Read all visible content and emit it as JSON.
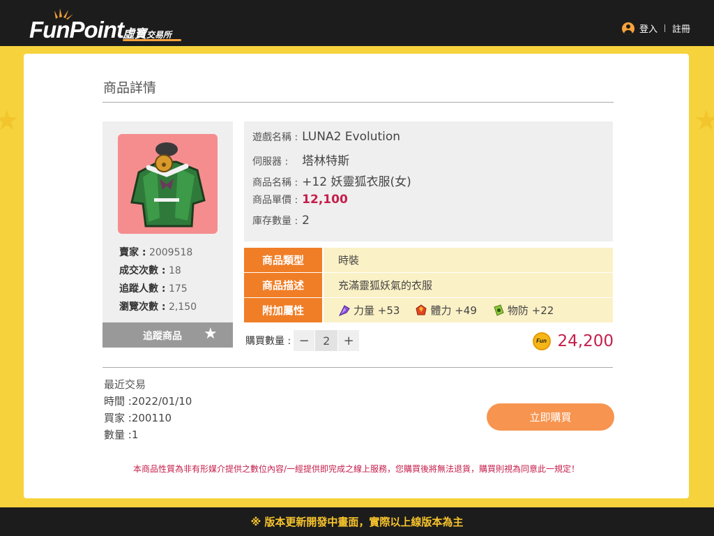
{
  "header": {
    "logo_text_main": "FunPoint",
    "logo_text_sub": "虛寶",
    "logo_text_sub_small": "交易所",
    "login_label": "登入",
    "register_label": "註冊"
  },
  "page_title": "商品詳情",
  "seller_panel": {
    "seller_label": "賣家 :",
    "seller_value": "2009518",
    "deals_label": "成交次數 :",
    "deals_value": "18",
    "followers_label": "追蹤人數 :",
    "followers_value": "175",
    "views_label": "瀏覽次數 :",
    "views_value": "2,150",
    "follow_button": "追蹤商品"
  },
  "product_info": {
    "game_label": "遊戲名稱 :",
    "game_value": "LUNA2 Evolution",
    "server_label": "伺服器 :",
    "server_value": "塔林特斯",
    "name_label": "商品名稱 :",
    "name_value": "+12 妖靈狐衣服(女)",
    "price_label": "商品單價 :",
    "price_value": "12,100",
    "stock_label": "庫存數量 :",
    "stock_value": "2"
  },
  "attributes": {
    "type_label": "商品類型",
    "type_value": "時裝",
    "desc_label": "商品描述",
    "desc_value": "充滿靈狐妖氣的衣服",
    "bonus_label": "附加屬性",
    "bonus_stats": [
      {
        "icon": "purple-gem-icon",
        "text": "力量 +53"
      },
      {
        "icon": "red-gem-icon",
        "text": "體力 +49"
      },
      {
        "icon": "green-gem-icon",
        "text": "物防 +22"
      }
    ]
  },
  "purchase": {
    "qty_label": "購買數量 :",
    "minus": "−",
    "qty_value": "2",
    "plus": "+",
    "coin_text": "Fun",
    "total_value": "24,200",
    "buy_button": "立即購買"
  },
  "recent_trade": {
    "heading": "最近交易",
    "time_label": "時間 :",
    "time_value": "2022/01/10",
    "buyer_label": "買家 :",
    "buyer_value": "200110",
    "qty_label": "數量 :",
    "qty_value": "1"
  },
  "disclaimer": "本商品性質為非有形媒介提供之數位內容/一經提供即完成之線上服務，您購買後將無法退貨，購買則視為同意此一規定！",
  "footer_notice": "※ 版本更新開發中畫面，實際以上線版本為主",
  "colors": {
    "accent_orange": "#f07e27",
    "price_red": "#c51e4b",
    "background_yellow": "#f6d33d",
    "header_dark": "#1c1c1c"
  }
}
